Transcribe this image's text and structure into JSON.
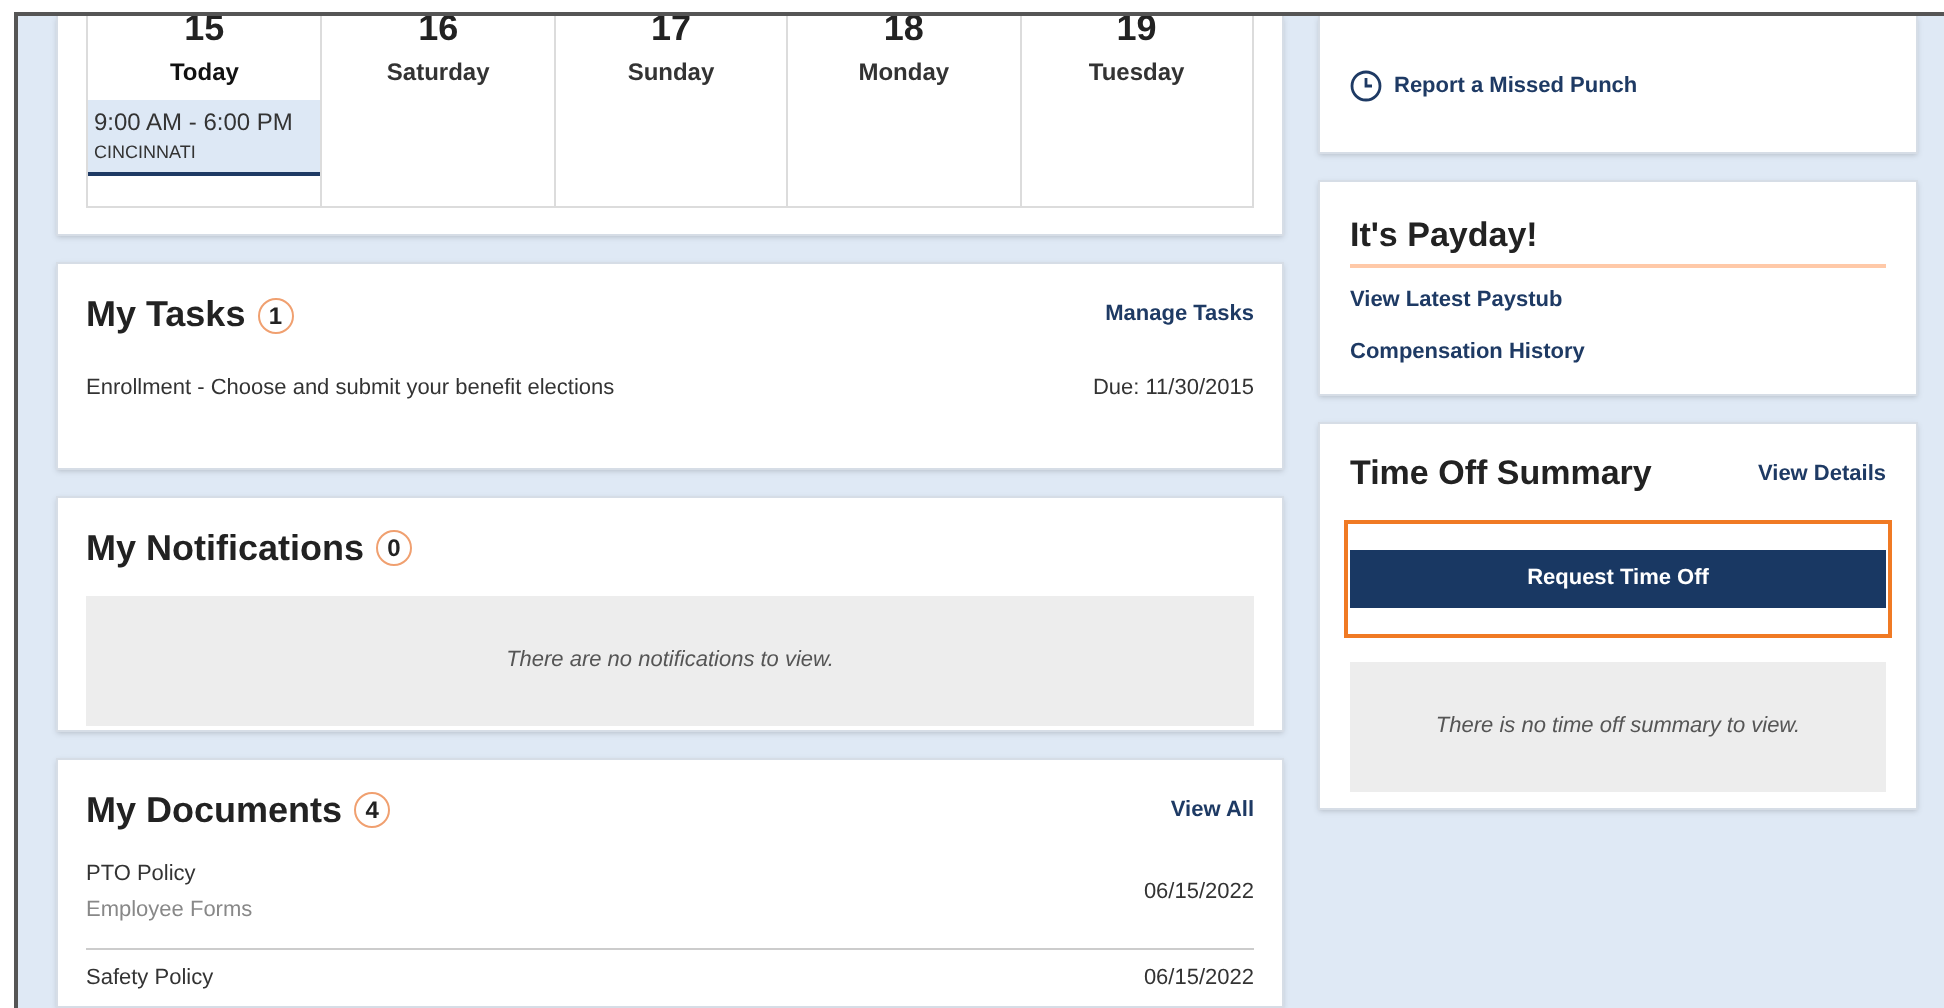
{
  "calendar": {
    "days": [
      {
        "number": "15",
        "label": "Today",
        "selected": true,
        "events": [
          {
            "time": "9:00 AM - 6:00 PM",
            "location": "CINCINNATI"
          }
        ]
      },
      {
        "number": "16",
        "label": "Saturday",
        "selected": false
      },
      {
        "number": "17",
        "label": "Sunday",
        "selected": false
      },
      {
        "number": "18",
        "label": "Monday",
        "selected": false
      },
      {
        "number": "19",
        "label": "Tuesday",
        "selected": false
      }
    ]
  },
  "tasks": {
    "title": "My Tasks",
    "count": "1",
    "link": "Manage Tasks",
    "items": [
      {
        "text": "Enrollment - Choose and submit your benefit elections",
        "due": "Due: 11/30/2015"
      }
    ]
  },
  "notifications": {
    "title": "My Notifications",
    "count": "0",
    "empty": "There are no notifications to view."
  },
  "documents": {
    "title": "My Documents",
    "count": "4",
    "link": "View All",
    "items": [
      {
        "name": "PTO Policy",
        "category": "Employee Forms",
        "date": "06/15/2022"
      },
      {
        "name": "Safety Policy",
        "date": "06/15/2022"
      }
    ]
  },
  "missed_punch": {
    "link": "Report a Missed Punch"
  },
  "payday": {
    "title": "It's Payday!",
    "links": [
      "View Latest Paystub",
      "Compensation History"
    ]
  },
  "time_off": {
    "title": "Time Off Summary",
    "link": "View Details",
    "button": {
      "label": "Request Time Off",
      "highlighted": true
    },
    "empty": "There is no time off summary to view."
  }
}
